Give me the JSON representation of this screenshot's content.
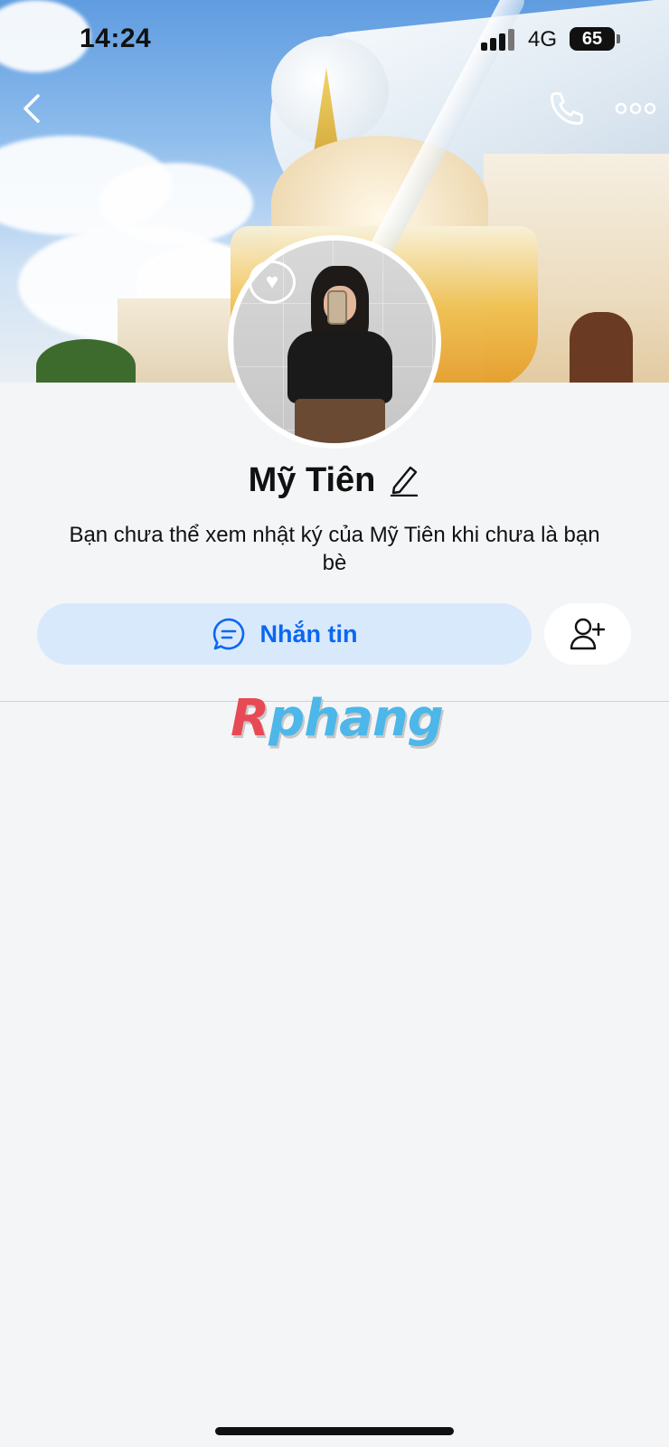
{
  "status_bar": {
    "time": "14:24",
    "network": "4G",
    "battery": "65"
  },
  "nav": {
    "back_icon": "chevron-left-icon",
    "call_icon": "phone-icon",
    "more_icon": "more-horizontal-icon"
  },
  "profile": {
    "name": "Mỹ Tiên",
    "notice": "Bạn chưa thể xem nhật ký của Mỹ Tiên khi chưa là bạn bè"
  },
  "actions": {
    "message_label": "Nhắn tin",
    "message_icon": "chat-bubble-icon",
    "add_friend_icon": "add-user-icon"
  },
  "watermark": {
    "first": "R",
    "rest": "phang"
  },
  "colors": {
    "accent": "#0a68f0",
    "message_button_bg": "#d9e9fc",
    "background": "#f4f5f7"
  }
}
